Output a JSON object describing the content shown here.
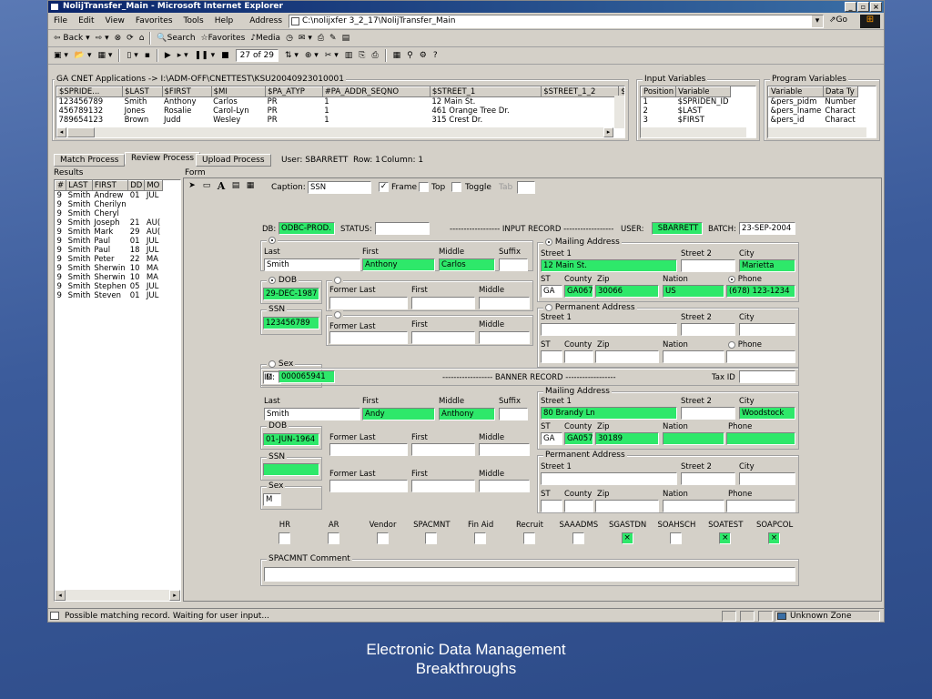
{
  "window": {
    "title": "NolijTransfer_Main - Microsoft Internet Explorer"
  },
  "menu": [
    "File",
    "Edit",
    "View",
    "Favorites",
    "Tools",
    "Help"
  ],
  "address": {
    "label": "Address",
    "value": "C:\\nolijxfer 3_2_17\\NolijTransfer_Main",
    "go": "Go"
  },
  "toolbar": {
    "back": "Back",
    "search": "Search",
    "favorites": "Favorites",
    "media": "Media"
  },
  "player": {
    "counter": "27 of 29"
  },
  "applications": {
    "caption": "GA CNET Applications -> I:\\ADM-OFF\\CNETTEST\\KSU20040923010001",
    "columns": [
      "$SPRIDE...",
      "$LAST",
      "$FIRST",
      "$MI",
      "$PA_ATYP",
      "#PA_ADDR_SEQNO",
      "$STREET_1",
      "$STREET_1_2",
      "$S"
    ],
    "rows": [
      [
        "123456789",
        "Smith",
        "Anthony",
        "Carlos",
        "PR",
        "1",
        "12 Main St.",
        "",
        ""
      ],
      [
        "456789132",
        "Jones",
        "Rosalie",
        "Carol-Lyn",
        "PR",
        "1",
        "461 Orange Tree Dr.",
        "",
        ""
      ],
      [
        "789654123",
        "Brown",
        "Judd",
        "Wesley",
        "PR",
        "1",
        "315 Crest Dr.",
        "",
        ""
      ]
    ]
  },
  "input_vars": {
    "title": "Input Variables",
    "columns": [
      "Position",
      "Variable"
    ],
    "rows": [
      [
        "1",
        "$SPRIDEN_ID"
      ],
      [
        "2",
        "$LAST"
      ],
      [
        "3",
        "$FIRST"
      ]
    ]
  },
  "program_vars": {
    "title": "Program Variables",
    "columns": [
      "Variable",
      "Data Ty"
    ],
    "rows": [
      [
        "&pers_pidm",
        "Number"
      ],
      [
        "&pers_lname",
        "Charact"
      ],
      [
        "&pers_id",
        "Charact"
      ]
    ]
  },
  "tabs": [
    "Match Process",
    "Review Process",
    "Upload Process"
  ],
  "status_info": {
    "user": "User: SBARRETT",
    "row": "Row: 1",
    "column": "Column: 1"
  },
  "results": {
    "title": "Results",
    "columns": [
      "#",
      "LAST",
      "FIRST",
      "DD",
      "MO"
    ],
    "rows": [
      [
        "9",
        "Smith",
        "Andrew",
        "01",
        "JUL"
      ],
      [
        "9",
        "Smith",
        "Cherilyn",
        "",
        ""
      ],
      [
        "9",
        "Smith",
        "Cheryl",
        "",
        ""
      ],
      [
        "9",
        "Smith",
        "Joseph",
        "21",
        "AU("
      ],
      [
        "9",
        "Smith",
        "Mark",
        "29",
        "AU("
      ],
      [
        "9",
        "Smith",
        "Paul",
        "01",
        "JUL"
      ],
      [
        "9",
        "Smith",
        "Paul",
        "18",
        "JUL"
      ],
      [
        "9",
        "Smith",
        "Peter",
        "22",
        "MA"
      ],
      [
        "9",
        "Smith",
        "Sherwin",
        "10",
        "MA"
      ],
      [
        "9",
        "Smith",
        "Sherwin",
        "10",
        "MA"
      ],
      [
        "9",
        "Smith",
        "Stephen",
        "05",
        "JUL"
      ],
      [
        "9",
        "Smith",
        "Steven",
        "01",
        "JUL"
      ]
    ]
  },
  "form": {
    "title": "Form",
    "caption_label": "Caption:",
    "caption_value": "SSN",
    "frame": "Frame",
    "top": "Top",
    "toggle": "Toggle",
    "tab": "Tab"
  },
  "record": {
    "db_label": "DB:",
    "db_value": "ODBC-PROD.",
    "status_label": "STATUS:",
    "status_value": "",
    "input_title": "------------------ INPUT RECORD ------------------",
    "user_label": "USER:",
    "user_value": "SBARRETT",
    "batch_label": "BATCH:",
    "batch_value": "23-SEP-2004",
    "last": "Last",
    "first": "First",
    "middle": "Middle",
    "suffix": "Suffix",
    "in_last": "Smith",
    "in_first": "Anthony",
    "in_middle": "Carlos",
    "in_suffix": "",
    "dob": "DOB",
    "in_dob": "29-DEC-1987",
    "former_last": "Former Last",
    "ssn": "SSN",
    "in_ssn": "123456789",
    "sex": "Sex",
    "in_sex": "M",
    "mailing": "Mailing Address",
    "street1": "Street 1",
    "street2": "Street 2",
    "city": "City",
    "st": "ST",
    "county": "County",
    "zip": "Zip",
    "nation": "Nation",
    "phone": "Phone",
    "in_street1": "12 Main St.",
    "in_city": "Marietta",
    "in_st": "GA",
    "in_county": "GA067",
    "in_zip": "30066",
    "in_nation": "US",
    "in_phone": "(678) 123-1234",
    "permanent": "Permanent Address",
    "id_label": "ID:",
    "id_value": "000065941",
    "banner_title": "------------------ BANNER RECORD ------------------",
    "taxid": "Tax ID",
    "bn_last": "Smith",
    "bn_first": "Andy",
    "bn_middle": "Anthony",
    "bn_dob": "01-JUN-1964",
    "bn_sex": "M",
    "bn_street1": "80 Brandy Ln",
    "bn_city": "Woodstock",
    "bn_st": "GA",
    "bn_county": "GA057",
    "bn_zip": "30189"
  },
  "flags": [
    {
      "label": "HR",
      "checked": false
    },
    {
      "label": "AR",
      "checked": false
    },
    {
      "label": "Vendor",
      "checked": false
    },
    {
      "label": "SPACMNT",
      "checked": false
    },
    {
      "label": "Fin Aid",
      "checked": false
    },
    {
      "label": "Recruit",
      "checked": false
    },
    {
      "label": "SAAADMS",
      "checked": false
    },
    {
      "label": "SGASTDN",
      "checked": true
    },
    {
      "label": "SOAHSCH",
      "checked": false
    },
    {
      "label": "SOATEST",
      "checked": true
    },
    {
      "label": "SOAPCOL",
      "checked": true
    }
  ],
  "comment": {
    "label": "SPACMNT Comment",
    "value": ""
  },
  "statusbar": {
    "message": "Possible matching record.  Waiting for user input...",
    "zone": "Unknown Zone"
  },
  "slide": {
    "line1": "Electronic Data Management",
    "line2": "Breakthroughs"
  },
  "colors": {
    "highlight": "#2ee86a",
    "titlebar": "#0a246a",
    "chrome": "#d4d0c8"
  }
}
